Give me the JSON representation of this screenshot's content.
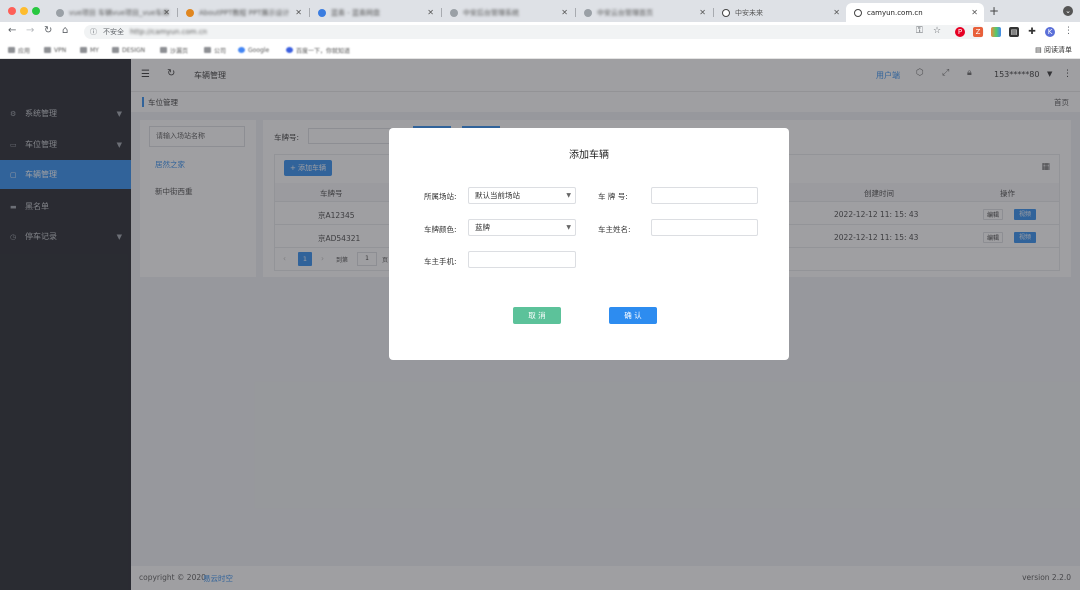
{
  "browser": {
    "tabs": [
      {
        "title": "vue项目 车辆vue项目_vue车库"
      },
      {
        "title": "AboutPPT教程 PPT展示设计"
      },
      {
        "title": "蓝奏 - 蓝奏网盘"
      },
      {
        "title": "中安后台管理系统"
      },
      {
        "title": "中安云台管理首页"
      },
      {
        "title": "中安未来"
      },
      {
        "title": "camyun.com.cn"
      }
    ],
    "security_label": "不安全",
    "url": "http://camyun.com.cn",
    "bookmarks": [
      "应用",
      "VPN",
      "MY",
      "DESIGN",
      "沙漏页",
      "公司",
      "Google",
      "百度一下，你就知道"
    ],
    "reading_list": "阅读清单",
    "profile_initial": "K"
  },
  "sidebar": {
    "items": [
      {
        "label": "系统管理",
        "icon": "gear-icon"
      },
      {
        "label": "车位管理",
        "icon": "parking-icon"
      },
      {
        "label": "车辆管理",
        "icon": "car-icon"
      },
      {
        "label": "黑名单",
        "icon": "blacklist-icon"
      },
      {
        "label": "停车记录",
        "icon": "clock-icon"
      }
    ]
  },
  "topbar": {
    "breadcrumb": "车辆管理",
    "user_side_label": "用户端",
    "phone": "153*****80"
  },
  "subbar": {
    "tag": "车位管理",
    "home": "首页"
  },
  "stations": {
    "search_placeholder": "请输入场站名称",
    "items": [
      "居然之家",
      "新中街西重"
    ]
  },
  "main": {
    "plate_label": "车牌号:",
    "add_button": "+ 添加车辆",
    "columns": [
      "车牌号",
      "创建时间",
      "操作"
    ],
    "rows": [
      {
        "plate": "京A12345",
        "created": "2022-12-12 11: 15: 43",
        "edit": "编辑",
        "video": "视频"
      },
      {
        "plate": "京AD54321",
        "created": "2022-12-12 11: 15: 43",
        "edit": "编辑",
        "video": "视频"
      }
    ],
    "pagination": {
      "current": "1",
      "goto_label": "到第",
      "goto_value": "1",
      "page_suffix": "页"
    }
  },
  "footer": {
    "copyright": "copyright © 2020",
    "brand": "易云时空",
    "version": "version 2.2.0"
  },
  "modal": {
    "title": "添加车辆",
    "station_label": "所属场站:",
    "station_value": "默认当前场站",
    "plate_label": "车 牌 号:",
    "plate_value": "",
    "color_label": "车牌颜色:",
    "color_value": "蓝牌",
    "owner_label": "车主姓名:",
    "owner_value": "",
    "phone_label": "车主手机:",
    "phone_value": "",
    "cancel": "取 消",
    "confirm": "确 认"
  },
  "colors": {
    "accent": "#2d8cf0",
    "cancel": "#5cc29a",
    "sidebar": "#1f2229"
  }
}
